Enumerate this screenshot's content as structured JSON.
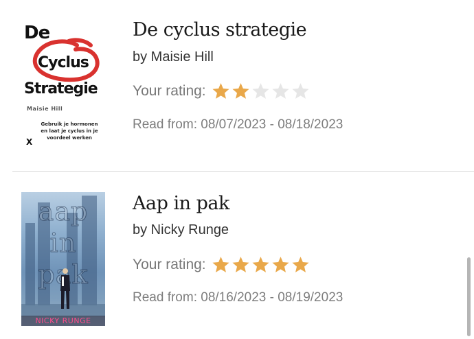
{
  "colors": {
    "star_filled": "#e9a84a",
    "star_empty": "#e6e6e6",
    "divider": "#d9d9d9",
    "cover_ring": "#d9322f"
  },
  "books": [
    {
      "title": "De cyclus strategie",
      "author": "by Maisie Hill",
      "rating_label": "Your rating:",
      "rating": 2,
      "rating_max": 5,
      "read_dates": "Read from: 08/07/2023 - 08/18/2023",
      "cover": {
        "line1": "De",
        "line2": "Cyclus",
        "line3": "Strategie",
        "author": "Maisie Hill",
        "tagline": "Gebruik je hormonen en laat je cyclus in je voordeel werken",
        "publisher_mark": "X"
      }
    },
    {
      "title": "Aap in pak",
      "author": "by Nicky Runge",
      "rating_label": "Your rating:",
      "rating": 5,
      "rating_max": 5,
      "read_dates": "Read from: 08/16/2023 - 08/19/2023",
      "cover": {
        "word1": "aap",
        "word2": "in",
        "word3": "pak",
        "author": "NICKY RUNGE"
      }
    }
  ]
}
